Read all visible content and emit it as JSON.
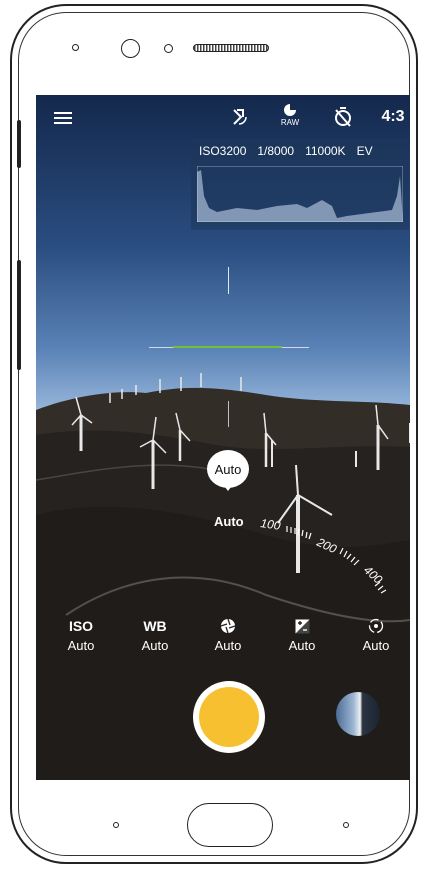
{
  "topbar": {
    "menu_icon": "hamburger-menu-icon",
    "rotate_icon": "rotate-icon",
    "raw_label": "RAW",
    "timer_icon": "timer-off-icon",
    "aspect_ratio": "4:3"
  },
  "histogram": {
    "iso": "ISO3200",
    "shutter": "1/8000",
    "wb": "11000K",
    "ev": "EV"
  },
  "focus": {
    "bubble_label": "Auto",
    "selected_label": "Auto",
    "dial_ticks": [
      "100",
      "200",
      "400"
    ]
  },
  "params": [
    {
      "label": "ISO",
      "value": "Auto"
    },
    {
      "label": "WB",
      "value": "Auto"
    },
    {
      "label": "",
      "icon": "aperture-icon",
      "value": "Auto"
    },
    {
      "label": "",
      "icon": "exposure-icon",
      "value": "Auto"
    },
    {
      "label": "",
      "icon": "focus-mode-icon",
      "value": "Auto"
    }
  ],
  "colors": {
    "shutter": "#f7c031",
    "level_green": "#6ec33a"
  }
}
